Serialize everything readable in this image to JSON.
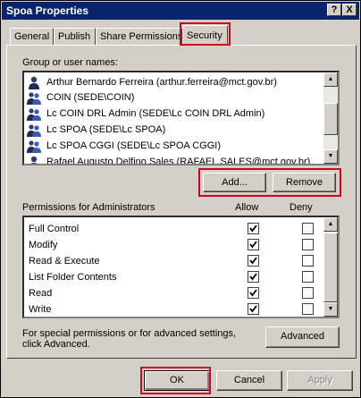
{
  "window": {
    "title": "Spoa Properties",
    "help_glyph": "?",
    "close_glyph": "X"
  },
  "tabs": [
    "General",
    "Publish",
    "Share Permissions",
    "Security"
  ],
  "users": {
    "label": "Group or user names:",
    "items": [
      "Arthur Bernardo Ferreira (arthur.ferreira@mct.gov.br)",
      "COIN (SEDE\\COIN)",
      "Lc COIN DRL Admin (SEDE\\Lc COIN DRL Admin)",
      "Lc SPOA (SEDE\\Lc SPOA)",
      "Lc SPOA CGGI (SEDE\\Lc SPOA CGGI)",
      "Rafael Augusto Delfino Sales (RAFAEL.SALES@mct.gov.br)"
    ]
  },
  "user_buttons": {
    "add": "Add...",
    "remove": "Remove"
  },
  "permissions": {
    "label": "Permissions for Administrators",
    "allow_header": "Allow",
    "deny_header": "Deny",
    "rows": [
      {
        "name": "Full Control",
        "allow": true,
        "deny": false
      },
      {
        "name": "Modify",
        "allow": true,
        "deny": false
      },
      {
        "name": "Read & Execute",
        "allow": true,
        "deny": false
      },
      {
        "name": "List Folder Contents",
        "allow": true,
        "deny": false
      },
      {
        "name": "Read",
        "allow": true,
        "deny": false
      },
      {
        "name": "Write",
        "allow": true,
        "deny": false
      }
    ]
  },
  "advanced": {
    "text_line1": "For special permissions or for advanced settings,",
    "text_line2": "click Advanced.",
    "button": "Advanced"
  },
  "dialog_buttons": {
    "ok": "OK",
    "cancel": "Cancel",
    "apply": "Apply"
  },
  "colors": {
    "highlight": "#d1001f",
    "titlebar": "#0a246a",
    "face": "#d4d0c8"
  }
}
